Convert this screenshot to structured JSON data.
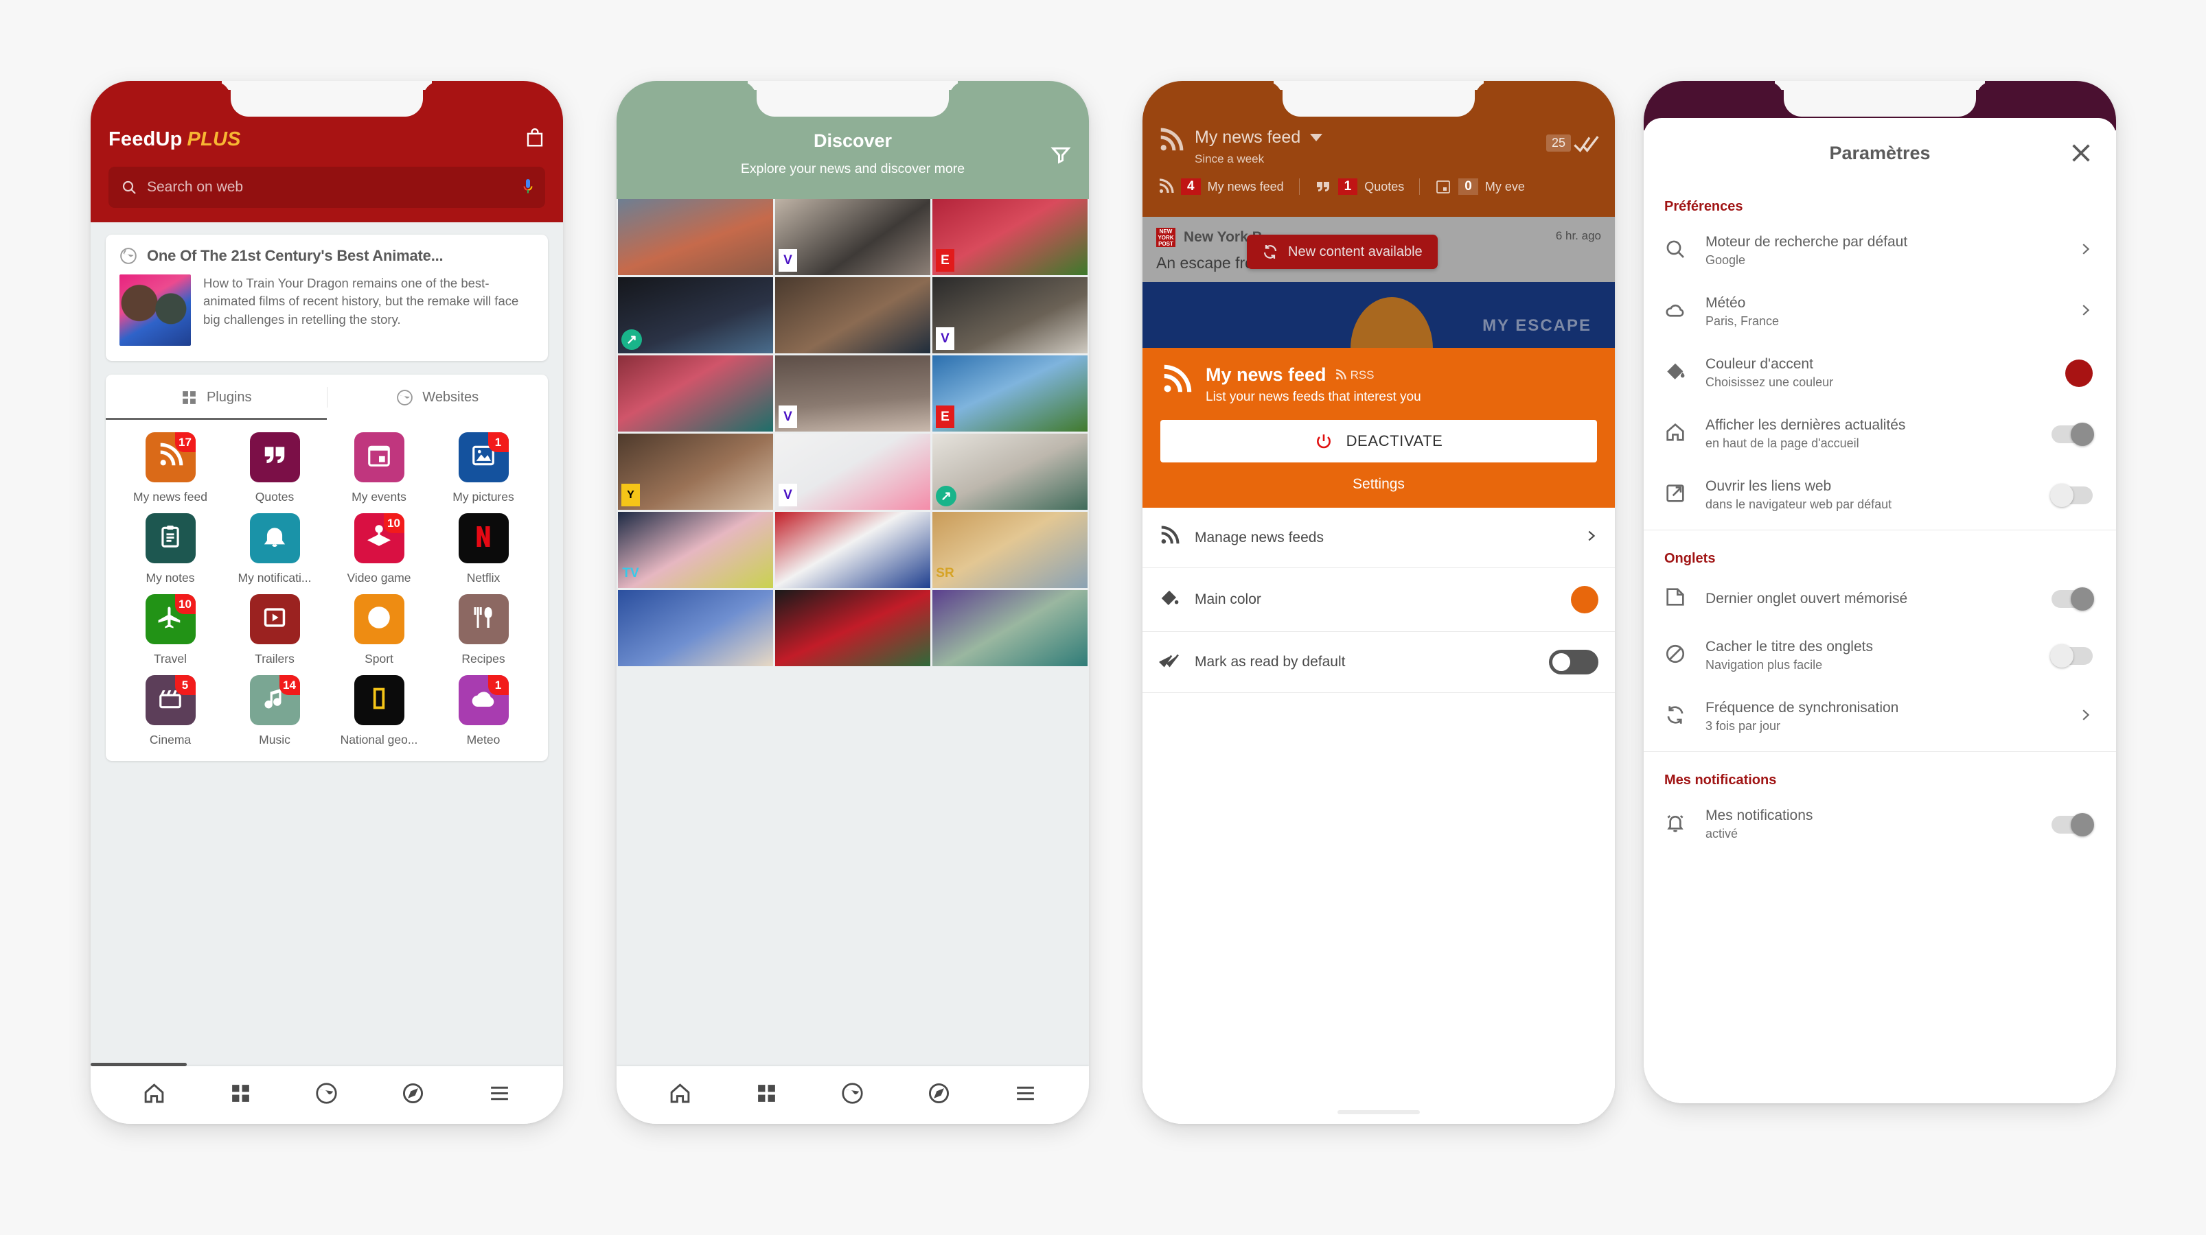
{
  "phone1": {
    "brand": {
      "name": "FeedUp",
      "plus": "PLUS",
      "bag_icon": "shopping-bag-icon"
    },
    "search": {
      "placeholder": "Search on web",
      "search_icon": "search-icon",
      "mic_icon": "microphone-icon"
    },
    "news_card": {
      "source_icon": "globe-icon",
      "title": "One Of The 21st Century's Best Animate...",
      "excerpt": "How to Train Your Dragon remains one of the best-animated films of recent history, but the remake will face big challenges in retelling the story."
    },
    "tabs": [
      {
        "label": "Plugins",
        "icon": "grid-icon",
        "selected": true
      },
      {
        "label": "Websites",
        "icon": "globe-icon",
        "selected": false
      }
    ],
    "plugins": [
      {
        "label": "My news feed",
        "icon": "rss-icon",
        "color": "#da6a18",
        "badge": "17"
      },
      {
        "label": "Quotes",
        "icon": "quote-icon",
        "color": "#7b0f47",
        "badge": ""
      },
      {
        "label": "My events",
        "icon": "calendar-icon",
        "color": "#c0367e",
        "badge": ""
      },
      {
        "label": "My pictures",
        "icon": "image-icon",
        "color": "#14529e",
        "badge": "1"
      },
      {
        "label": "My notes",
        "icon": "clipboard-icon",
        "color": "#1d5750",
        "badge": ""
      },
      {
        "label": "My notificati...",
        "icon": "bell-icon",
        "color": "#1a93a8",
        "badge": ""
      },
      {
        "label": "Video game",
        "icon": "joystick-icon",
        "color": "#d91042",
        "badge": "10"
      },
      {
        "label": "Netflix",
        "icon": "netflix-icon",
        "color": "#0b0b0b",
        "badge": ""
      },
      {
        "label": "Travel",
        "icon": "plane-icon",
        "color": "#229316",
        "badge": "10"
      },
      {
        "label": "Trailers",
        "icon": "play-icon",
        "color": "#9b2220",
        "badge": ""
      },
      {
        "label": "Sport",
        "icon": "basketball-icon",
        "color": "#ee8c12",
        "badge": ""
      },
      {
        "label": "Recipes",
        "icon": "cutlery-icon",
        "color": "#8c6862",
        "badge": ""
      },
      {
        "label": "Cinema",
        "icon": "clapper-icon",
        "color": "#5c3e59",
        "badge": "5"
      },
      {
        "label": "Music",
        "icon": "music-icon",
        "color": "#7aa693",
        "badge": "14"
      },
      {
        "label": "National geo...",
        "icon": "natgeo-icon",
        "color": "#0b0b0b",
        "badge": ""
      },
      {
        "label": "Meteo",
        "icon": "cloud-icon",
        "color": "#a83cb0",
        "badge": "1"
      }
    ],
    "nav": [
      {
        "icon": "home-icon"
      },
      {
        "icon": "grid-icon"
      },
      {
        "icon": "globe-icon"
      },
      {
        "icon": "compass-icon"
      },
      {
        "icon": "menu-icon"
      }
    ]
  },
  "phone2": {
    "header": {
      "title": "Discover",
      "subtitle": "Explore your news and discover more",
      "filter_icon": "filter-icon",
      "bg": "#8faf96"
    },
    "tiles": [
      {
        "name": "man-with-phone-city",
        "badge": ""
      },
      {
        "name": "headphones-in-hands",
        "badge": "V"
      },
      {
        "name": "liverpool-players",
        "badge": "E"
      },
      {
        "name": "flighty-app-promo",
        "badge": "arrow"
      },
      {
        "name": "man-in-shop-payment",
        "badge": ""
      },
      {
        "name": "soundbar-under-tv",
        "badge": "V"
      },
      {
        "name": "actress-red-hair",
        "badge": ""
      },
      {
        "name": "rocket-launch-streak",
        "badge": "V"
      },
      {
        "name": "guardiola-trophy",
        "badge": "E"
      },
      {
        "name": "robin-williams",
        "badge": "Y"
      },
      {
        "name": "pink-earbuds",
        "badge": "V"
      },
      {
        "name": "woman-at-laptop",
        "badge": "arrow"
      },
      {
        "name": "comic-con-actress",
        "badge": "TV"
      },
      {
        "name": "nfl-fox-logo",
        "badge": ""
      },
      {
        "name": "lion-king-cub",
        "badge": "SR"
      },
      {
        "name": "blonde-woman-blue",
        "badge": ""
      },
      {
        "name": "poinsettia-couple",
        "badge": ""
      },
      {
        "name": "woman-green-cap",
        "badge": ""
      }
    ],
    "nav": [
      {
        "icon": "home-icon"
      },
      {
        "icon": "grid-icon"
      },
      {
        "icon": "globe-icon"
      },
      {
        "icon": "compass-icon"
      },
      {
        "icon": "menu-icon"
      }
    ]
  },
  "phone3": {
    "appbar": {
      "icon": "rss-icon",
      "title": "My news feed",
      "subtitle": "Since a week",
      "read_count": "25",
      "read_icon": "double-check-icon",
      "chips": [
        {
          "icon": "rss-icon",
          "count": "4",
          "label": "My news feed"
        },
        {
          "icon": "quote-icon",
          "count": "1",
          "label": "Quotes"
        },
        {
          "icon": "calendar-icon",
          "count": "0",
          "label": "My eve"
        }
      ]
    },
    "article": {
      "source": "New York P",
      "source_icon": "nyp-logo",
      "title": "An escape fro",
      "time": "6 hr. ago",
      "image_caption": "MY ESCAPE"
    },
    "toast": {
      "label": "New content available",
      "icon": "refresh-icon",
      "color": "#a41414"
    },
    "panel": {
      "icon": "rss-icon",
      "title": "My news feed",
      "rss_label": "RSS",
      "subtitle": "List your news feeds that interest you",
      "button": {
        "label": "DEACTIVATE",
        "icon": "power-icon"
      },
      "settings_label": "Settings",
      "color": "#e8670c"
    },
    "settings": [
      {
        "label": "Manage news feeds",
        "icon": "rss-icon",
        "control": "chevron"
      },
      {
        "label": "Main color",
        "icon": "paint-bucket-icon",
        "control": "color",
        "color": "#e8670c"
      },
      {
        "label": "Mark as read by default",
        "icon": "double-check-icon",
        "control": "switch-off"
      }
    ]
  },
  "phone4": {
    "title": "Paramètres",
    "close_icon": "close-icon",
    "sections": [
      {
        "heading": "Préférences",
        "rows": [
          {
            "icon": "search-icon",
            "title": "Moteur de recherche par défaut",
            "sub": "Google",
            "control": "chevron"
          },
          {
            "icon": "cloud-icon",
            "title": "Météo",
            "sub": "Paris, France",
            "control": "chevron"
          },
          {
            "icon": "paint-bucket-icon",
            "title": "Couleur d'accent",
            "sub": "Choisissez une couleur",
            "control": "color",
            "color": "#a81313"
          },
          {
            "icon": "home-icon",
            "title": "Afficher les dernières actualités",
            "sub": "en haut de la page d'accueil",
            "control": "switch-on"
          },
          {
            "icon": "external-link-icon",
            "title": "Ouvrir les liens web",
            "sub": "dans le navigateur web par défaut",
            "control": "switch-off"
          }
        ]
      },
      {
        "heading": "Onglets",
        "rows": [
          {
            "icon": "tab-icon",
            "title": "Dernier onglet ouvert mémorisé",
            "sub": "",
            "control": "switch-on"
          },
          {
            "icon": "no-title-icon",
            "title": "Cacher le titre des onglets",
            "sub": "Navigation plus facile",
            "control": "switch-off"
          },
          {
            "icon": "sync-icon",
            "title": "Fréquence de synchronisation",
            "sub": "3 fois par jour",
            "control": "chevron"
          }
        ]
      },
      {
        "heading": "Mes notifications",
        "rows": [
          {
            "icon": "bell-ring-icon",
            "title": "Mes notifications",
            "sub": "activé",
            "control": "switch-on"
          }
        ]
      }
    ]
  },
  "colors": {
    "background": "#f7f7f7",
    "phone1_accent": "#a81313",
    "phone2_accent": "#8faf96",
    "phone3_accent": "#e8670c",
    "phone4_accent": "#a81313",
    "badge_red": "#f21b1b"
  }
}
